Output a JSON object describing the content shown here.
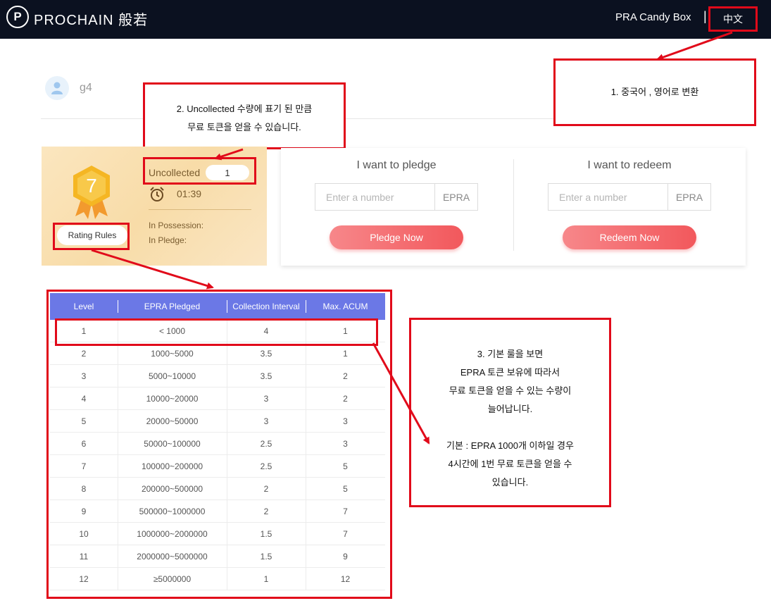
{
  "header": {
    "logo_mark": "P",
    "logo_text": "PROCHAIN 般若",
    "nav_candy_box": "PRA Candy Box",
    "nav_separator": "|",
    "nav_language": "中文"
  },
  "user": {
    "name": "g4"
  },
  "annotations": {
    "note1": "1. 중국어 , 영어로 변환",
    "note2_line1": "2. Uncollected 수량에 표기 된 만큼",
    "note2_line2": "무료 토큰을 얻을 수 있습니다.",
    "note3_lines": [
      "3. 기본 룰을 보면",
      "EPRA 토큰 보유에 따라서",
      "무료 토큰을 얻을 수 있는 수량이",
      "늘어납니다.",
      "",
      "기본 : EPRA 1000개 이하일 경우",
      "4시간에 1번 무료 토큰을 얻을 수",
      "있습니다."
    ]
  },
  "level_card": {
    "level": "7",
    "rating_rules": "Rating Rules",
    "uncollected_label": "Uncollected",
    "uncollected_value": "1",
    "timer": "01:39",
    "in_possession": "In Possession:",
    "in_pledge": "In Pledge:"
  },
  "pledge": {
    "title": "I want to pledge",
    "placeholder": "Enter a number",
    "unit": "EPRA",
    "button": "Pledge Now"
  },
  "redeem": {
    "title": "I want to redeem",
    "placeholder": "Enter a number",
    "unit": "EPRA",
    "button": "Redeem Now"
  },
  "table": {
    "headers": [
      "Level",
      "EPRA Pledged",
      "Collection Interval",
      "Max. ACUM"
    ],
    "rows": [
      [
        "1",
        "< 1000",
        "4",
        "1"
      ],
      [
        "2",
        "1000~5000",
        "3.5",
        "1"
      ],
      [
        "3",
        "5000~10000",
        "3.5",
        "2"
      ],
      [
        "4",
        "10000~20000",
        "3",
        "2"
      ],
      [
        "5",
        "20000~50000",
        "3",
        "3"
      ],
      [
        "6",
        "50000~100000",
        "2.5",
        "3"
      ],
      [
        "7",
        "100000~200000",
        "2.5",
        "5"
      ],
      [
        "8",
        "200000~500000",
        "2",
        "5"
      ],
      [
        "9",
        "500000~1000000",
        "2",
        "7"
      ],
      [
        "10",
        "1000000~2000000",
        "1.5",
        "7"
      ],
      [
        "11",
        "2000000~5000000",
        "1.5",
        "9"
      ],
      [
        "12",
        "≥5000000",
        "1",
        "12"
      ]
    ]
  },
  "colors": {
    "header_bg": "#0b1120",
    "annotation_red": "#e10a1a",
    "table_header": "#6b78e6",
    "button_red": "#f2585c",
    "badge_gold": "#f5b623"
  },
  "icons": [
    "prochain-logo-icon",
    "user-icon",
    "level-badge-icon",
    "alarm-clock-icon"
  ]
}
